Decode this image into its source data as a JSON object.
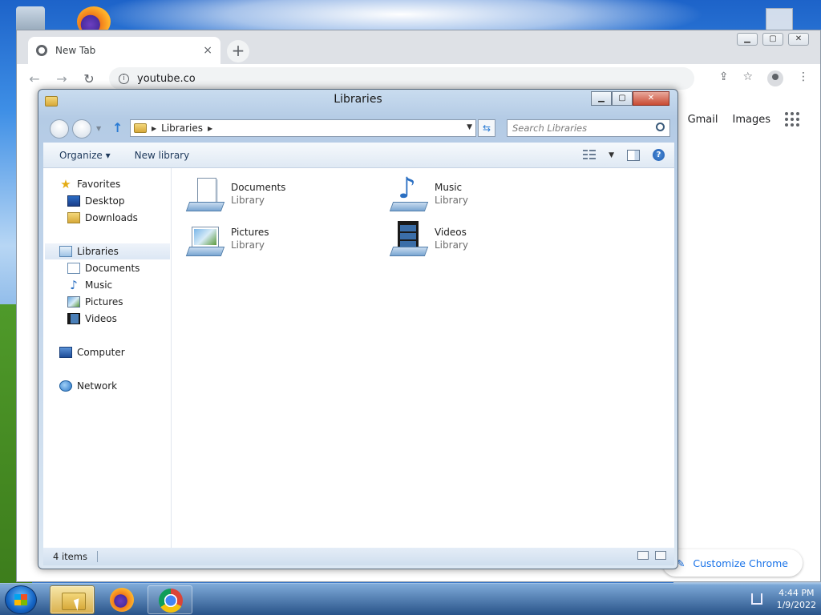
{
  "chrome": {
    "tab_title": "New Tab",
    "tab_close": "×",
    "new_tab": "+",
    "url": "youtube.co",
    "links": {
      "gmail": "Gmail",
      "images": "Images"
    },
    "customize": "Customize Chrome",
    "window_controls": {
      "minimize": "▁",
      "maximize": "▢",
      "close": "✕"
    }
  },
  "explorer": {
    "title": "Libraries",
    "breadcrumb": "Libraries",
    "search_placeholder": "Search Libraries",
    "toolbar": {
      "organize": "Organize ▾",
      "new_library": "New library"
    },
    "window_controls": {
      "minimize": "▁",
      "maximize": "▢",
      "close": "✕"
    },
    "nav": {
      "favorites": "Favorites",
      "desktop": "Desktop",
      "downloads": "Downloads",
      "libraries": "Libraries",
      "documents": "Documents",
      "music": "Music",
      "pictures": "Pictures",
      "videos": "Videos",
      "computer": "Computer",
      "network": "Network"
    },
    "libraries": [
      {
        "name": "Documents",
        "type": "Library"
      },
      {
        "name": "Music",
        "type": "Library"
      },
      {
        "name": "Pictures",
        "type": "Library"
      },
      {
        "name": "Videos",
        "type": "Library"
      }
    ],
    "status": "4 items"
  },
  "taskbar": {
    "time": "4:44 PM",
    "date": "1/9/2022"
  },
  "colors": {
    "chrome_accent": "#1a73e8",
    "explorer_frame": "#b4cbe5",
    "close_button": "#c84a32"
  }
}
